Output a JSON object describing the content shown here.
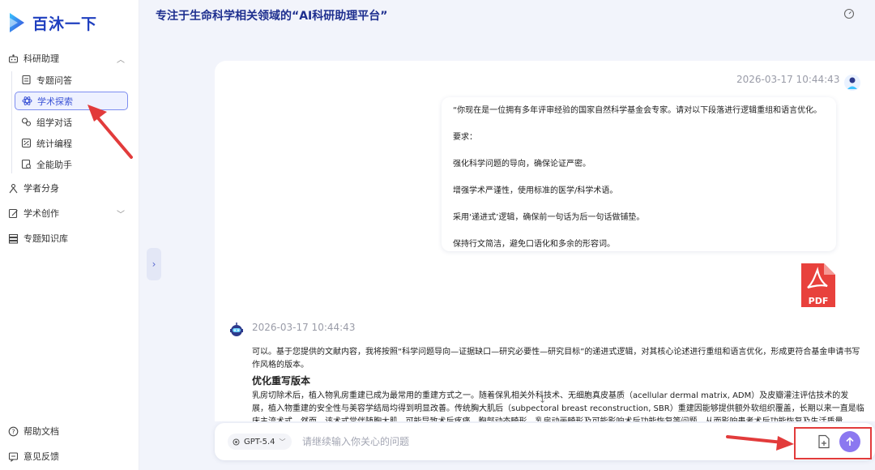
{
  "app": {
    "name": "百沐一下"
  },
  "header": {
    "title": "专注于生命科学相关领域的“AI科研助理平台”"
  },
  "sidebar": {
    "groups": [
      {
        "label": "科研助理",
        "icon": "research-assistant-icon"
      },
      {
        "label": "学者分身",
        "icon": "scholar-avatar-icon"
      },
      {
        "label": "学术创作",
        "icon": "academic-writing-icon"
      },
      {
        "label": "专题知识库",
        "icon": "knowledge-base-icon"
      }
    ],
    "sub_items": [
      {
        "label": "专题问答",
        "icon": "topic-qa-icon"
      },
      {
        "label": "学术探索",
        "icon": "academic-explore-icon",
        "active": true
      },
      {
        "label": "组学对话",
        "icon": "omics-chat-icon"
      },
      {
        "label": "统计编程",
        "icon": "stats-programming-icon"
      },
      {
        "label": "全能助手",
        "icon": "all-round-assistant-icon"
      }
    ],
    "bottom": [
      {
        "label": "帮助文档",
        "icon": "help-icon"
      },
      {
        "label": "意见反馈",
        "icon": "feedback-icon"
      }
    ]
  },
  "chat": {
    "user_message": {
      "timestamp": "2026-03-17 10:44:43",
      "paragraphs": [
        "“你现在是一位拥有多年评审经验的国家自然科学基金会专家。请对以下段落进行逻辑重组和语言优化。",
        "要求：",
        "强化科学问题的导向，确保论证严密。",
        "增强学术严谨性，使用标准的医学/科学术语。",
        "采用‘递进式’逻辑，确保前一句话为后一句话做铺垫。",
        "保持行文简洁，避免口语化和多余的形容词。"
      ],
      "attachment": {
        "type": "PDF",
        "icon": "pdf-file-icon"
      }
    },
    "assistant_message": {
      "timestamp": "2026-03-17 10:44:43",
      "intro": "可以。基于您提供的文献内容，我将按照“科学问题导向—证据缺口—研究必要性—研究目标”的递进式逻辑，对其核心论述进行重组和语言优化，形成更符合基金申请书写作风格的版本。",
      "heading": "优化重写版本",
      "body": "乳房切除术后，植入物乳房重建已成为最常用的重建方式之一。随着保乳相关外科技术、无细胞真皮基质（acellular dermal matrix, ADM）及皮瓣灌注评估技术的发展，植入物重建的安全性与美容学结局均得到明显改善。传统胸大肌后（subpectoral breast reconstruction, SBR）重建因能够提供额外软组织覆盖，长期以来一直是临床主流术式，然而，该术式常伴随胸大肌...可能导致术后疼痛、胸部动态畸形、乳房动画畸形及可能影响术后功能恢复等问题，从而影响患者术后功能恢复及生活质量。"
    }
  },
  "input": {
    "model": "GPT-5.4",
    "placeholder": "请继续输入你关心的问题"
  },
  "colors": {
    "brand": "#1f3fbf",
    "accent": "#8b78f0",
    "annotation": "#e23b3b",
    "pdf_red": "#e8413c"
  }
}
